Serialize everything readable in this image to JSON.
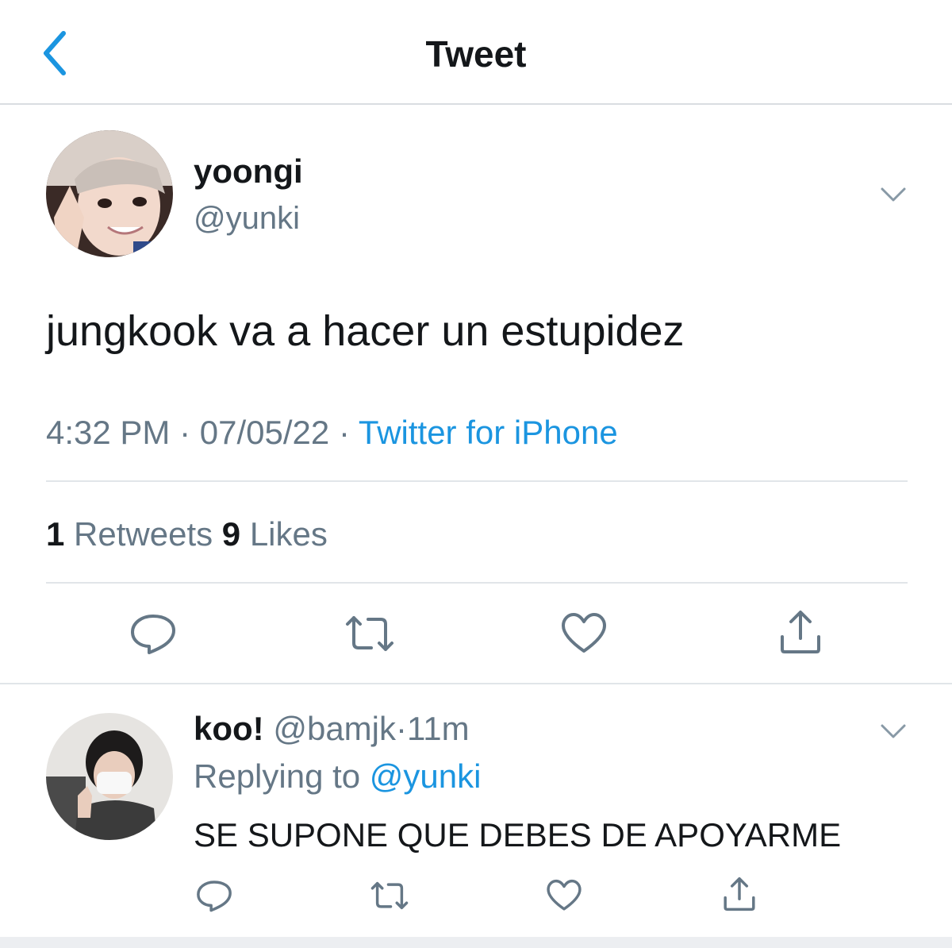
{
  "header": {
    "title": "Tweet",
    "back_icon": "chevron-left-icon"
  },
  "colors": {
    "accent": "#1b95e0",
    "secondary_text": "#657786",
    "primary_text": "#14171a",
    "divider": "#e1e5e9"
  },
  "tweet": {
    "display_name": "yoongi",
    "handle": "@yunki",
    "text": "jungkook va a hacer un estupidez",
    "time": "4:32 PM",
    "date": "07/05/22",
    "source": "Twitter for iPhone",
    "separator": "·",
    "retweets_count": "1",
    "retweets_label": "Retweets",
    "likes_count": "9",
    "likes_label": "Likes",
    "actions": [
      "reply-icon",
      "retweet-icon",
      "like-icon",
      "share-icon"
    ]
  },
  "reply": {
    "display_name": "koo!",
    "handle": "@bamjk",
    "separator": "·",
    "time": "11m",
    "replying_label": "Replying to",
    "replying_handle": "@yunki",
    "text": "SE SUPONE QUE DEBES DE APOYARME",
    "actions": [
      "reply-icon",
      "retweet-icon",
      "like-icon",
      "share-icon"
    ]
  }
}
